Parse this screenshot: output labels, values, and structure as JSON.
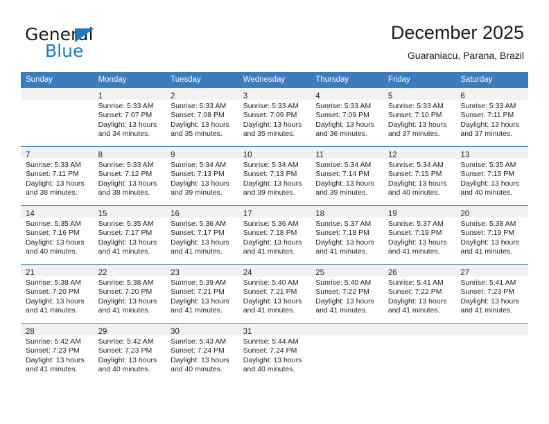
{
  "brand": {
    "name_part1": "General",
    "name_part2": "Blue",
    "triangle_color": "#1f77be"
  },
  "header": {
    "title": "December 2025",
    "subtitle": "Guaraniacu, Parana, Brazil"
  },
  "theme": {
    "header_row_bg": "#3b7cbf",
    "daynum_band_bg": "#f1f1f1",
    "row_divider": "#4a86c5",
    "text": "#222222"
  },
  "labels": {
    "sunrise_prefix": "Sunrise: ",
    "sunset_prefix": "Sunset: ",
    "daylight_prefix": "Daylight: "
  },
  "weekday_headers": [
    "Sunday",
    "Monday",
    "Tuesday",
    "Wednesday",
    "Thursday",
    "Friday",
    "Saturday"
  ],
  "weeks": [
    [
      {
        "day": "",
        "sunrise": "",
        "sunset": "",
        "daylight_line1": "",
        "daylight_line2": ""
      },
      {
        "day": "1",
        "sunrise": "Sunrise: 5:33 AM",
        "sunset": "Sunset: 7:07 PM",
        "daylight_line1": "Daylight: 13 hours",
        "daylight_line2": "and 34 minutes."
      },
      {
        "day": "2",
        "sunrise": "Sunrise: 5:33 AM",
        "sunset": "Sunset: 7:08 PM",
        "daylight_line1": "Daylight: 13 hours",
        "daylight_line2": "and 35 minutes."
      },
      {
        "day": "3",
        "sunrise": "Sunrise: 5:33 AM",
        "sunset": "Sunset: 7:09 PM",
        "daylight_line1": "Daylight: 13 hours",
        "daylight_line2": "and 35 minutes."
      },
      {
        "day": "4",
        "sunrise": "Sunrise: 5:33 AM",
        "sunset": "Sunset: 7:09 PM",
        "daylight_line1": "Daylight: 13 hours",
        "daylight_line2": "and 36 minutes."
      },
      {
        "day": "5",
        "sunrise": "Sunrise: 5:33 AM",
        "sunset": "Sunset: 7:10 PM",
        "daylight_line1": "Daylight: 13 hours",
        "daylight_line2": "and 37 minutes."
      },
      {
        "day": "6",
        "sunrise": "Sunrise: 5:33 AM",
        "sunset": "Sunset: 7:11 PM",
        "daylight_line1": "Daylight: 13 hours",
        "daylight_line2": "and 37 minutes."
      }
    ],
    [
      {
        "day": "7",
        "sunrise": "Sunrise: 5:33 AM",
        "sunset": "Sunset: 7:11 PM",
        "daylight_line1": "Daylight: 13 hours",
        "daylight_line2": "and 38 minutes."
      },
      {
        "day": "8",
        "sunrise": "Sunrise: 5:33 AM",
        "sunset": "Sunset: 7:12 PM",
        "daylight_line1": "Daylight: 13 hours",
        "daylight_line2": "and 38 minutes."
      },
      {
        "day": "9",
        "sunrise": "Sunrise: 5:34 AM",
        "sunset": "Sunset: 7:13 PM",
        "daylight_line1": "Daylight: 13 hours",
        "daylight_line2": "and 39 minutes."
      },
      {
        "day": "10",
        "sunrise": "Sunrise: 5:34 AM",
        "sunset": "Sunset: 7:13 PM",
        "daylight_line1": "Daylight: 13 hours",
        "daylight_line2": "and 39 minutes."
      },
      {
        "day": "11",
        "sunrise": "Sunrise: 5:34 AM",
        "sunset": "Sunset: 7:14 PM",
        "daylight_line1": "Daylight: 13 hours",
        "daylight_line2": "and 39 minutes."
      },
      {
        "day": "12",
        "sunrise": "Sunrise: 5:34 AM",
        "sunset": "Sunset: 7:15 PM",
        "daylight_line1": "Daylight: 13 hours",
        "daylight_line2": "and 40 minutes."
      },
      {
        "day": "13",
        "sunrise": "Sunrise: 5:35 AM",
        "sunset": "Sunset: 7:15 PM",
        "daylight_line1": "Daylight: 13 hours",
        "daylight_line2": "and 40 minutes."
      }
    ],
    [
      {
        "day": "14",
        "sunrise": "Sunrise: 5:35 AM",
        "sunset": "Sunset: 7:16 PM",
        "daylight_line1": "Daylight: 13 hours",
        "daylight_line2": "and 40 minutes."
      },
      {
        "day": "15",
        "sunrise": "Sunrise: 5:35 AM",
        "sunset": "Sunset: 7:17 PM",
        "daylight_line1": "Daylight: 13 hours",
        "daylight_line2": "and 41 minutes."
      },
      {
        "day": "16",
        "sunrise": "Sunrise: 5:36 AM",
        "sunset": "Sunset: 7:17 PM",
        "daylight_line1": "Daylight: 13 hours",
        "daylight_line2": "and 41 minutes."
      },
      {
        "day": "17",
        "sunrise": "Sunrise: 5:36 AM",
        "sunset": "Sunset: 7:18 PM",
        "daylight_line1": "Daylight: 13 hours",
        "daylight_line2": "and 41 minutes."
      },
      {
        "day": "18",
        "sunrise": "Sunrise: 5:37 AM",
        "sunset": "Sunset: 7:18 PM",
        "daylight_line1": "Daylight: 13 hours",
        "daylight_line2": "and 41 minutes."
      },
      {
        "day": "19",
        "sunrise": "Sunrise: 5:37 AM",
        "sunset": "Sunset: 7:19 PM",
        "daylight_line1": "Daylight: 13 hours",
        "daylight_line2": "and 41 minutes."
      },
      {
        "day": "20",
        "sunrise": "Sunrise: 5:38 AM",
        "sunset": "Sunset: 7:19 PM",
        "daylight_line1": "Daylight: 13 hours",
        "daylight_line2": "and 41 minutes."
      }
    ],
    [
      {
        "day": "21",
        "sunrise": "Sunrise: 5:38 AM",
        "sunset": "Sunset: 7:20 PM",
        "daylight_line1": "Daylight: 13 hours",
        "daylight_line2": "and 41 minutes."
      },
      {
        "day": "22",
        "sunrise": "Sunrise: 5:38 AM",
        "sunset": "Sunset: 7:20 PM",
        "daylight_line1": "Daylight: 13 hours",
        "daylight_line2": "and 41 minutes."
      },
      {
        "day": "23",
        "sunrise": "Sunrise: 5:39 AM",
        "sunset": "Sunset: 7:21 PM",
        "daylight_line1": "Daylight: 13 hours",
        "daylight_line2": "and 41 minutes."
      },
      {
        "day": "24",
        "sunrise": "Sunrise: 5:40 AM",
        "sunset": "Sunset: 7:21 PM",
        "daylight_line1": "Daylight: 13 hours",
        "daylight_line2": "and 41 minutes."
      },
      {
        "day": "25",
        "sunrise": "Sunrise: 5:40 AM",
        "sunset": "Sunset: 7:22 PM",
        "daylight_line1": "Daylight: 13 hours",
        "daylight_line2": "and 41 minutes."
      },
      {
        "day": "26",
        "sunrise": "Sunrise: 5:41 AM",
        "sunset": "Sunset: 7:22 PM",
        "daylight_line1": "Daylight: 13 hours",
        "daylight_line2": "and 41 minutes."
      },
      {
        "day": "27",
        "sunrise": "Sunrise: 5:41 AM",
        "sunset": "Sunset: 7:23 PM",
        "daylight_line1": "Daylight: 13 hours",
        "daylight_line2": "and 41 minutes."
      }
    ],
    [
      {
        "day": "28",
        "sunrise": "Sunrise: 5:42 AM",
        "sunset": "Sunset: 7:23 PM",
        "daylight_line1": "Daylight: 13 hours",
        "daylight_line2": "and 41 minutes."
      },
      {
        "day": "29",
        "sunrise": "Sunrise: 5:42 AM",
        "sunset": "Sunset: 7:23 PM",
        "daylight_line1": "Daylight: 13 hours",
        "daylight_line2": "and 40 minutes."
      },
      {
        "day": "30",
        "sunrise": "Sunrise: 5:43 AM",
        "sunset": "Sunset: 7:24 PM",
        "daylight_line1": "Daylight: 13 hours",
        "daylight_line2": "and 40 minutes."
      },
      {
        "day": "31",
        "sunrise": "Sunrise: 5:44 AM",
        "sunset": "Sunset: 7:24 PM",
        "daylight_line1": "Daylight: 13 hours",
        "daylight_line2": "and 40 minutes."
      },
      {
        "day": "",
        "sunrise": "",
        "sunset": "",
        "daylight_line1": "",
        "daylight_line2": ""
      },
      {
        "day": "",
        "sunrise": "",
        "sunset": "",
        "daylight_line1": "",
        "daylight_line2": ""
      },
      {
        "day": "",
        "sunrise": "",
        "sunset": "",
        "daylight_line1": "",
        "daylight_line2": ""
      }
    ]
  ]
}
